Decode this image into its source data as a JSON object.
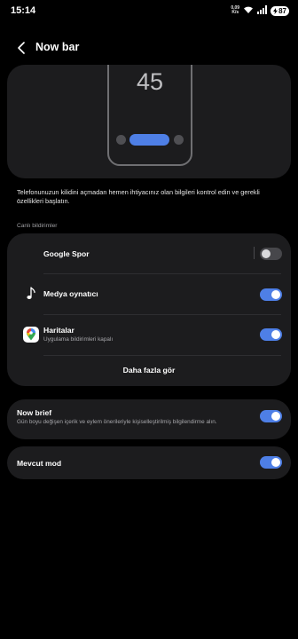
{
  "status_bar": {
    "time": "15:14",
    "net_speed_value": "0,09",
    "net_speed_unit": "K/s",
    "battery_level": "87",
    "icons": [
      "wifi-icon",
      "signal-icon",
      "battery-icon"
    ]
  },
  "header": {
    "title": "Now bar",
    "back_icon": "back-arrow-icon"
  },
  "preview": {
    "clock": "45",
    "accent_color": "#4e7fe6"
  },
  "description": "Telefonunuzun kilidini açmadan hemen ihtiyacınız olan bilgileri kontrol edin ve gerekli özellikleri başlatın.",
  "live_notifications": {
    "section_label": "Canlı bildirimler",
    "items": [
      {
        "label": "Google Spor",
        "subtitle": "",
        "enabled": false,
        "icon": ""
      },
      {
        "label": "Medya oynatıcı",
        "subtitle": "",
        "enabled": true,
        "icon": "music-note-icon"
      },
      {
        "label": "Haritalar",
        "subtitle": "Uygulama bildirimleri kapalı",
        "enabled": true,
        "icon": "google-maps-icon"
      }
    ],
    "more_label": "Daha fazla gör"
  },
  "now_brief": {
    "label": "Now brief",
    "subtitle": "Gün boyu değişen içerik ve eylem önerileriyle kişiselleştirilmiş bilgilendirme alın.",
    "enabled": true
  },
  "current_mode": {
    "label": "Mevcut mod",
    "enabled": true
  },
  "colors": {
    "background": "#000000",
    "card": "#1c1c1e",
    "toggle_on": "#4e7fe6",
    "toggle_off": "#47474b"
  }
}
